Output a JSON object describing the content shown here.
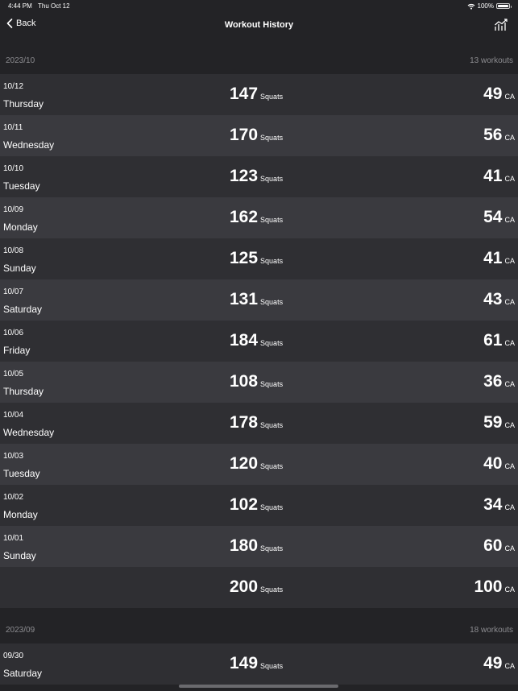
{
  "status": {
    "time": "4:44 PM",
    "date": "Thu Oct 12",
    "battery": "100%"
  },
  "nav": {
    "back_label": "Back",
    "title": "Workout History"
  },
  "icons": {
    "back": "chevron-left-icon",
    "chart": "chart-icon",
    "wifi": "wifi-icon",
    "battery": "battery-icon"
  },
  "colors": {
    "background": "#232326",
    "row_light": "#3a3a3f",
    "row_dark": "#2f2f33",
    "secondary_text": "#8c8c90"
  },
  "sections": [
    {
      "month": "2023/10",
      "count": "13 workouts",
      "rows": [
        {
          "date": "10/12",
          "weekday": "Thursday",
          "squats": "147",
          "squats_unit": "Squats",
          "cal": "49",
          "cal_unit": "CA"
        },
        {
          "date": "10/11",
          "weekday": "Wednesday",
          "squats": "170",
          "squats_unit": "Squats",
          "cal": "56",
          "cal_unit": "CA"
        },
        {
          "date": "10/10",
          "weekday": "Tuesday",
          "squats": "123",
          "squats_unit": "Squats",
          "cal": "41",
          "cal_unit": "CA"
        },
        {
          "date": "10/09",
          "weekday": "Monday",
          "squats": "162",
          "squats_unit": "Squats",
          "cal": "54",
          "cal_unit": "CA"
        },
        {
          "date": "10/08",
          "weekday": "Sunday",
          "squats": "125",
          "squats_unit": "Squats",
          "cal": "41",
          "cal_unit": "CA"
        },
        {
          "date": "10/07",
          "weekday": "Saturday",
          "squats": "131",
          "squats_unit": "Squats",
          "cal": "43",
          "cal_unit": "CA"
        },
        {
          "date": "10/06",
          "weekday": "Friday",
          "squats": "184",
          "squats_unit": "Squats",
          "cal": "61",
          "cal_unit": "CA"
        },
        {
          "date": "10/05",
          "weekday": "Thursday",
          "squats": "108",
          "squats_unit": "Squats",
          "cal": "36",
          "cal_unit": "CA"
        },
        {
          "date": "10/04",
          "weekday": "Wednesday",
          "squats": "178",
          "squats_unit": "Squats",
          "cal": "59",
          "cal_unit": "CA"
        },
        {
          "date": "10/03",
          "weekday": "Tuesday",
          "squats": "120",
          "squats_unit": "Squats",
          "cal": "40",
          "cal_unit": "CA"
        },
        {
          "date": "10/02",
          "weekday": "Monday",
          "squats": "102",
          "squats_unit": "Squats",
          "cal": "34",
          "cal_unit": "CA"
        },
        {
          "date": "10/01",
          "weekday": "Sunday",
          "squats": "180",
          "squats_unit": "Squats",
          "cal": "60",
          "cal_unit": "CA"
        },
        {
          "date": "",
          "weekday": "",
          "squats": "200",
          "squats_unit": "Squats",
          "cal": "100",
          "cal_unit": "CA"
        }
      ]
    },
    {
      "month": "2023/09",
      "count": "18 workouts",
      "rows": [
        {
          "date": "09/30",
          "weekday": "Saturday",
          "squats": "149",
          "squats_unit": "Squats",
          "cal": "49",
          "cal_unit": "CA"
        }
      ]
    }
  ]
}
